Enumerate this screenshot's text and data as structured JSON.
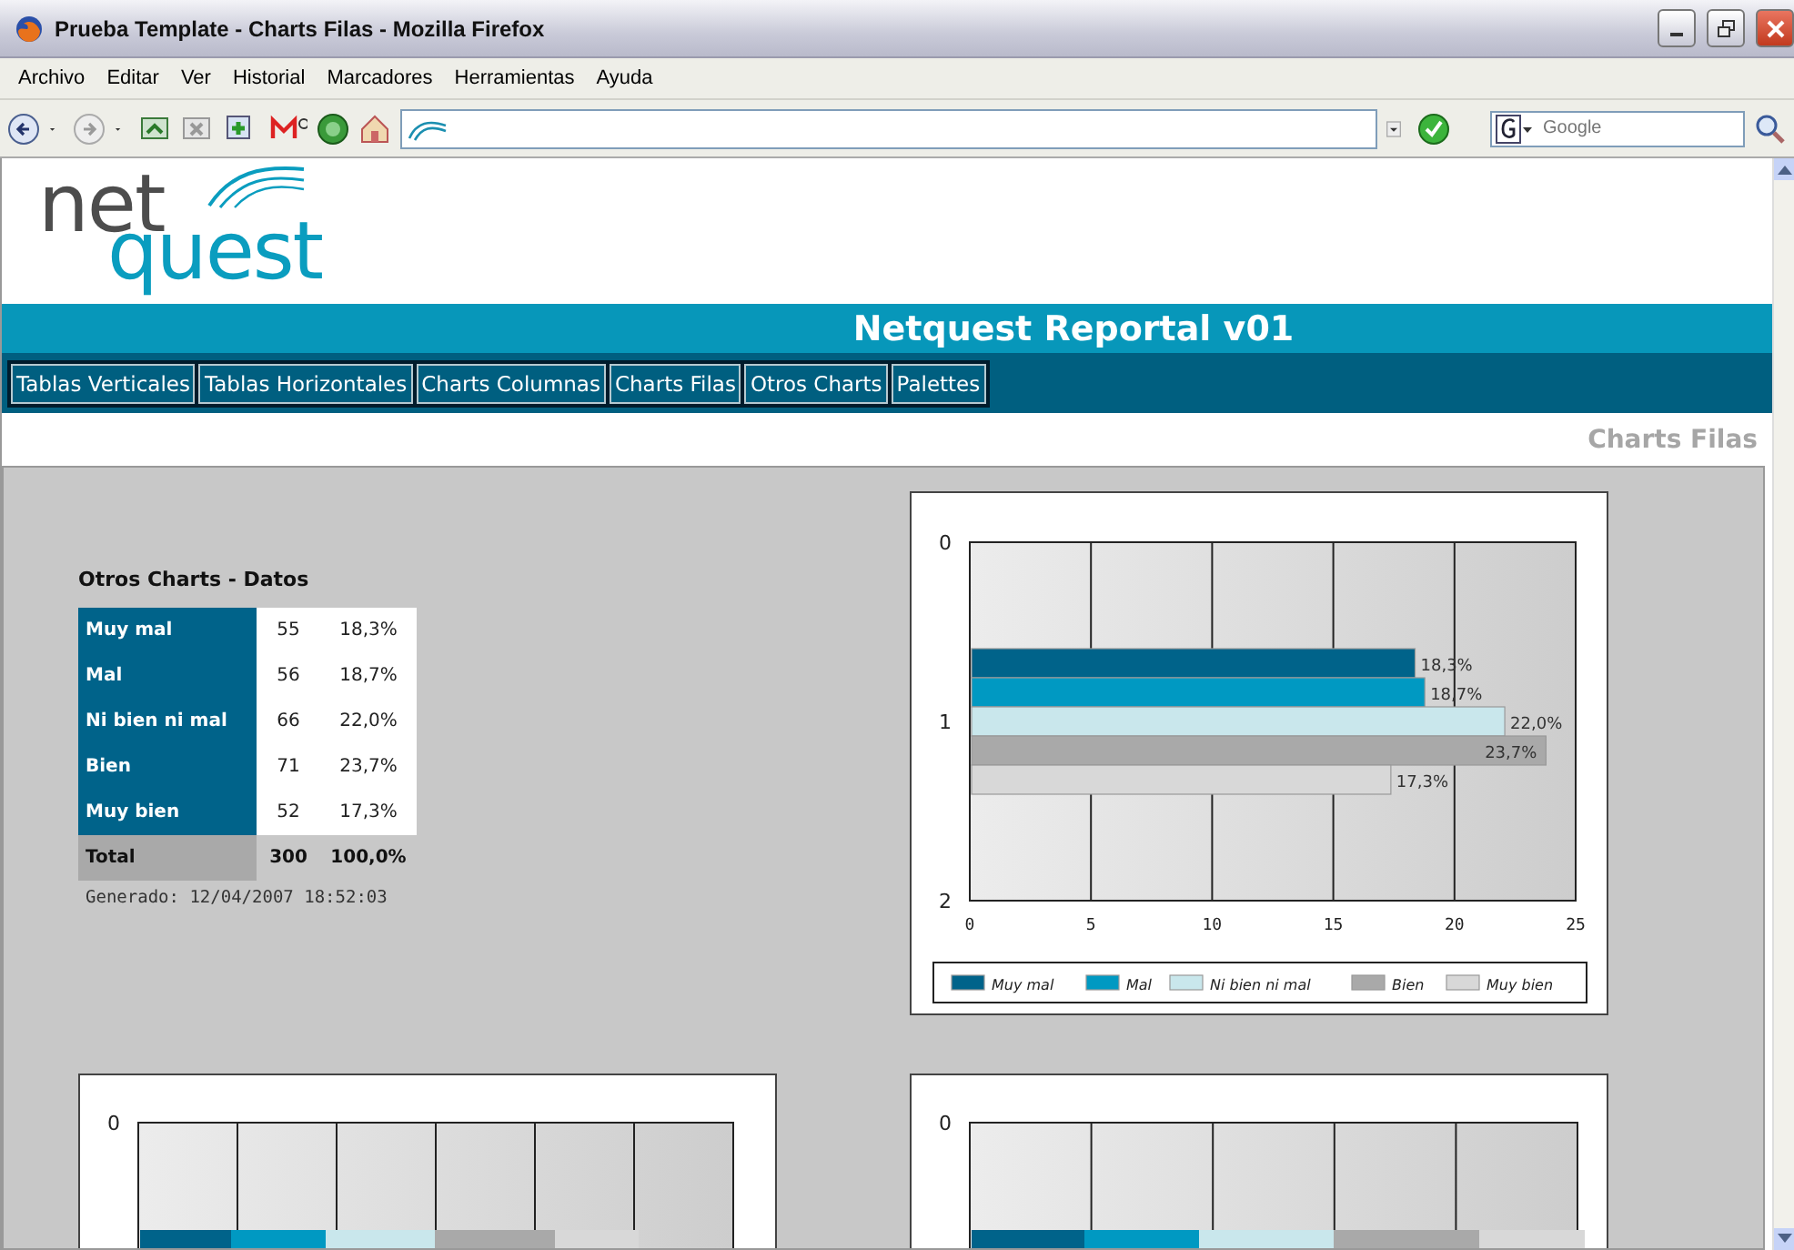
{
  "window": {
    "title": "Prueba Template - Charts Filas - Mozilla Firefox"
  },
  "menu": [
    "Archivo",
    "Editar",
    "Ver",
    "Historial",
    "Marcadores",
    "Herramientas",
    "Ayuda"
  ],
  "search": {
    "placeholder": "Google"
  },
  "site": {
    "logo_top": "net",
    "logo_bottom": "quest",
    "title": "Netquest Reportal v01"
  },
  "nav": [
    "Tablas Verticales",
    "Tablas Horizontales",
    "Charts Columnas",
    "Charts Filas",
    "Otros Charts",
    "Palettes"
  ],
  "page_title": "Charts Filas",
  "table": {
    "title": "Otros Charts - Datos",
    "rows": [
      {
        "label": "Muy mal",
        "count": "55",
        "percent": "18,3%"
      },
      {
        "label": "Mal",
        "count": "56",
        "percent": "18,7%"
      },
      {
        "label": "Ni bien ni mal",
        "count": "66",
        "percent": "22,0%"
      },
      {
        "label": "Bien",
        "count": "71",
        "percent": "23,7%"
      },
      {
        "label": "Muy bien",
        "count": "52",
        "percent": "17,3%"
      }
    ],
    "total": {
      "label": "Total",
      "count": "300",
      "percent": "100,0%"
    },
    "generated": "Generado: 12/04/2007 18:52:03"
  },
  "chart": {
    "chart_data": {
      "type": "bar",
      "orientation": "horizontal",
      "xlim": [
        0,
        25
      ],
      "xticks": [
        0,
        5,
        10,
        15,
        20,
        25
      ],
      "categories": [
        "0",
        "1",
        "2"
      ],
      "grid": true,
      "legend": true,
      "series": [
        {
          "name": "Muy mal",
          "color": "#00638a",
          "values": [
            null,
            18.3,
            null
          ],
          "value_labels": [
            null,
            "18,3%",
            null
          ]
        },
        {
          "name": "Mal",
          "color": "#0099c2",
          "values": [
            null,
            18.7,
            null
          ],
          "value_labels": [
            null,
            "18,7%",
            null
          ]
        },
        {
          "name": "Ni bien ni mal",
          "color": "#c9e7ec",
          "values": [
            null,
            22.0,
            null
          ],
          "value_labels": [
            null,
            "22,0%",
            null
          ]
        },
        {
          "name": "Bien",
          "color": "#a9a9a9",
          "values": [
            null,
            23.7,
            null
          ],
          "value_labels": [
            null,
            "23,7%",
            null
          ]
        },
        {
          "name": "Muy bien",
          "color": "#d8d8d8",
          "values": [
            null,
            17.3,
            null
          ],
          "value_labels": [
            null,
            "17,3%",
            null
          ]
        }
      ],
      "data_labels": true
    }
  },
  "lower_charts": [
    {
      "y_tick": "0"
    },
    {
      "y_tick": "0"
    }
  ]
}
